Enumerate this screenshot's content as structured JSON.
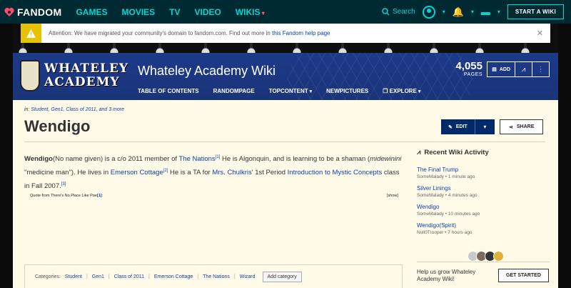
{
  "global_nav": {
    "brand": "FANDOM",
    "links": [
      "GAMES",
      "MOVIES",
      "TV",
      "VIDEO",
      "WIKIS"
    ],
    "search_label": "Search",
    "start_wiki": "START A WIKI"
  },
  "banner": {
    "text": "Attention: We have migrated your community's domain to fandom.com. Find out more in ",
    "link": "this Fandom help page"
  },
  "wiki": {
    "logo_line1": "WHATELEY",
    "logo_line2": "ACADEMY",
    "title": "Whateley Academy Wiki",
    "nav": [
      "TABLE OF CONTENTS",
      "RANDOMPAGE",
      "TOPCONTENT",
      "NEWPICTURES",
      "EXPLORE"
    ],
    "pages_count": "4,055",
    "pages_label": "PAGES",
    "add_label": "ADD"
  },
  "article": {
    "categories_prefix": "in:",
    "categories_top": [
      "Student",
      "Gen1",
      "Class of 2011"
    ],
    "categories_more": "and 3 more",
    "title": "Wendigo",
    "edit_label": "EDIT",
    "share_label": "SHARE",
    "p1_name": "Wendigo",
    "p1_a": "(No name given) is a c/o 2011 member of ",
    "p1_link1": "The Nations",
    "p1_ref1": "[1]",
    "p1_b": " He is Algonquin, and is learning to be a shaman (",
    "p1_italic": "midewinini",
    "p1_c": " \"medicine man\"). He lives in ",
    "p1_link2": "Emerson Cottage",
    "p1_ref2": "[2]",
    "p1_d": " He is a TA for ",
    "p1_link3": "Mrs. Chulkris",
    "p1_e": "' 1st Period ",
    "p1_link4": "Introduction to Mystic Concepts",
    "p1_f": " class in Fall 2007.",
    "p1_ref3": "[3]",
    "quote_text": "Quote from There's No Place Like Poe",
    "quote_ref": "[1]",
    "quote_colon": ":",
    "show_label": "[show]",
    "categories_label": "Categories:",
    "categories_bottom": [
      "Student",
      "Gen1",
      "Class of 2011",
      "Emerson Cottage",
      "The Nations",
      "Wizard"
    ],
    "add_category": "Add category"
  },
  "rail": {
    "title": "Recent Wiki Activity",
    "items": [
      {
        "title": "The Final Trump",
        "meta": "SomeMalady • 1 minute ago"
      },
      {
        "title": "Silver Linings",
        "meta": "SomeMalady • 4 minutes ago"
      },
      {
        "title": "Wendigo",
        "meta": "SomeMalady • 10 minutes ago"
      },
      {
        "title": "Wendigo(Spirit)",
        "meta": "Null0Trooper • 7 hours ago"
      }
    ],
    "grow_text": "Help us grow Whateley Academy Wiki!",
    "get_started": "GET STARTED"
  }
}
